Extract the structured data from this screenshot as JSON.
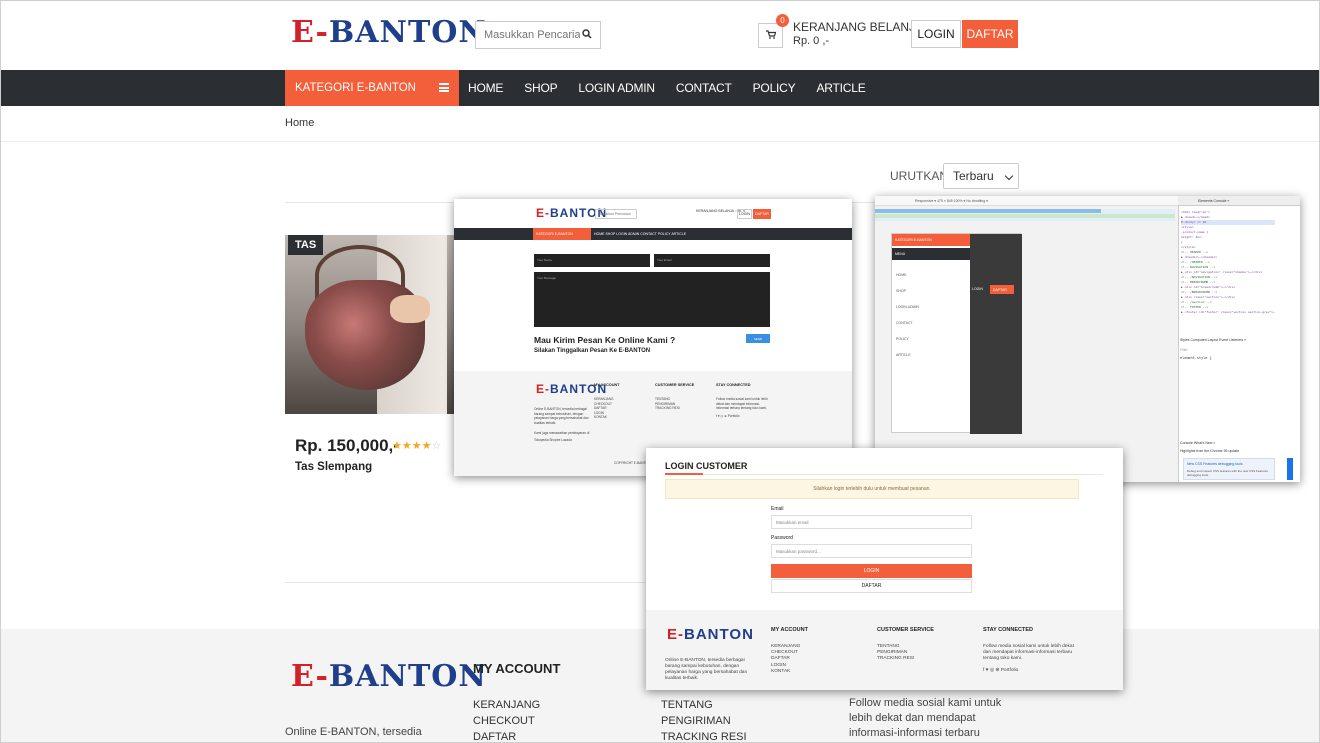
{
  "header": {
    "logo_text": "E-BANTON",
    "search_placeholder": "Masukkan Pencarian ...",
    "cart_count": "0",
    "cart_title": "KERANJANG BELANJA :",
    "cart_total": "Rp. 0 ,-",
    "login_label": "LOGIN",
    "daftar_label": "DAFTAR"
  },
  "nav": {
    "category_label": "KATEGORI E-BANTON",
    "items": [
      "HOME",
      "SHOP",
      "LOGIN ADMIN",
      "CONTACT",
      "POLICY",
      "ARTICLE"
    ]
  },
  "breadcrumb": "Home",
  "sort": {
    "label": "URUTKAN :",
    "selected": "Terbaru"
  },
  "product": {
    "tag": "TAS",
    "price": "Rp. 150,000,-",
    "rating": 4,
    "stars_filled": "★★★★",
    "stars_empty": "☆",
    "name": "Tas Slempang"
  },
  "footer": {
    "desc": "Online E-BANTON, tersedia berbagai",
    "my_account_title": "MY ACCOUNT",
    "my_account_links": [
      "KERANJANG",
      "CHECKOUT",
      "DAFTAR"
    ],
    "cs_links": [
      "TENTANG",
      "PENGIRIMAN",
      "TRACKING RESI"
    ],
    "social_text": "Follow media sosial kami untuk lebih dekat dan mendapat informasi-informasi terbaru tentang toko kami."
  },
  "overlay_contact": {
    "logo_text": "E-BANTON",
    "search_placeholder": "Masukkan Pencarian",
    "cart_text": "KERANJANG BELANJA : Rp. 0",
    "login": "LOGIN",
    "daftar": "DAFTAR",
    "category": "KATEGORI E-BANTON",
    "nav": "HOME   SHOP   LOGIN ADMIN   CONTACT   POLICY   ARTICLE",
    "field_name": "Your Name",
    "field_email": "Your Email",
    "field_message": "Your Message",
    "heading": "Mau Kirim Pesan Ke Online Kami ?",
    "subheading": "Silakan Tinggalkan Pesan Ke E-BANTON",
    "send": "SEND",
    "foot_my_account": "MY ACCOUNT",
    "foot_cs": "CUSTOMER SERVICE",
    "foot_stay": "STAY CONNECTED",
    "foot_links1": [
      "KERANJANG",
      "CHECKOUT",
      "DAFTAR",
      "LOGIN",
      "KONTAK"
    ],
    "foot_links2": [
      "TENTANG",
      "PENGIRIMAN",
      "TRACKING RESI"
    ],
    "foot_social": "Follow media sosial kami untuk lebih dekat dan mendapat informasi-informasi terbaru tentang toko kami.",
    "social_icons": "f  ♥  ◎  ⊕  Portfolio",
    "foot_desc": "Online E-BANTON, tersedia berbagai barang sampai kebutuhan, dengan pelayanan harga yang bersahabat dan kualitas terbaik.",
    "foot_payment": "Kami juga menawarkan pembayaran di",
    "foot_payment_methods": "Tokopedia   Shopee   Lazada",
    "copyright": "COPYRIGHT E-BANTON"
  },
  "overlay_devtools": {
    "toolbar": "Responsive ▾   475  ×  845   100% ▾  No throttling ▾",
    "phone_category": "KATEGORI E-BANTON",
    "phone_menu": "MENU",
    "phone_items": [
      "HOME",
      "SHOP",
      "LOGIN ADMIN",
      "CONTACT",
      "POLICY",
      "ARTICLE"
    ],
    "phone_login": "LOGIN",
    "phone_daftar": "DAFTAR",
    "tabs": "Elements   Console   »",
    "code_lines": [
      "<html lang=\"en\">",
      "▶ <head>…</head>",
      "▼ <body> == $0",
      "<style>",
      ".product-name {",
      "height: 3px;",
      "}",
      "</style>",
      "<!-- HEADER -->",
      "▶ <header>…</header>",
      "<!-- /HEADER -->",
      "<!-- NAVIGATION -->",
      "▶ <div id=\"navigation\" class=\"shadow\">…</div>",
      "<!-- /NAVIGATION -->",
      "<!-- BREADCRUMB -->",
      "▶ <div id=\"breadcrumb\">…</div>",
      "<!-- /BREADCRUMB -->",
      "▶ <div class=\"section\">…</div>",
      "<!-- /section -->",
      "<!-- FOOTER -->",
      "▶ <footer id=\"footer\" class=\"section section-grey\">…"
    ],
    "styles_tabs": "Styles   Computed   Layout   Event Listeners   »",
    "filter": "Filter",
    "element_style": "element.style {",
    "console_tabs": "Console   What's New ×",
    "highlights": "Highlights from the Chrome 99 update",
    "news_title": "New CSS Features debugging tools",
    "news_text": "Debug and inspect CSS features with the new CSS Features debugging tools."
  },
  "overlay_login": {
    "title": "LOGIN CUSTOMER",
    "alert": "Silahkan login terlebih dulu untuk membuat pesanan.",
    "email_label": "Email",
    "email_placeholder": "Masukkan email",
    "password_label": "Password",
    "password_placeholder": "Masukkan password...",
    "login_button": "LOGIN",
    "daftar_button": "DAFTAR",
    "logo_text": "E-BANTON",
    "foot_my_account": "MY ACCOUNT",
    "foot_cs": "CUSTOMER SERVICE",
    "foot_stay": "STAY CONNECTED",
    "foot_links1": [
      "KERANJANG",
      "CHECKOUT",
      "DAFTAR",
      "LOGIN",
      "KONTAK"
    ],
    "foot_links2": [
      "TENTANG",
      "PENGIRIMAN",
      "TRACKING RESI"
    ],
    "foot_social": "Follow media sosial kami untuk lebih dekat dan mendapat informasi-informasi terbaru tentang toko kami.",
    "social_icons": "f  ♥  ◎  ⊕  Portfolio",
    "foot_desc": "Online E-BANTON, tersedia berbagai barang sampai kebutuhan, dengan pelayanan harga yang bersahabat dan kualitas terbaik."
  }
}
